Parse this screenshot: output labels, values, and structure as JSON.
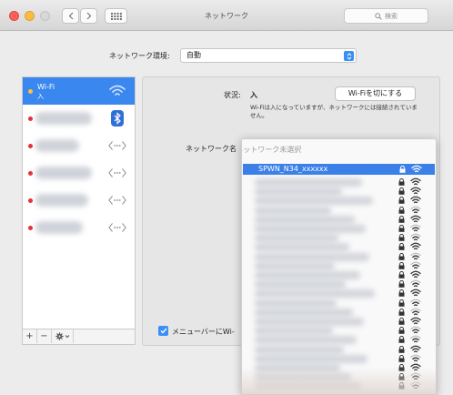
{
  "window": {
    "title": "ネットワーク",
    "search_placeholder": "検索"
  },
  "location": {
    "label": "ネットワーク環境:",
    "value": "自動"
  },
  "sidebar": {
    "items": [
      {
        "name": "Wi-Fi",
        "status": "入",
        "dot": "yellow",
        "icon": "wifi-icon",
        "selected": true
      },
      {
        "name": "",
        "status": "",
        "dot": "red",
        "icon": "bluetooth-icon",
        "selected": false
      },
      {
        "name": "",
        "status": "",
        "dot": "red",
        "icon": "ethernet-icon",
        "selected": false
      },
      {
        "name": "",
        "status": "",
        "dot": "red",
        "icon": "ethernet-icon",
        "selected": false
      },
      {
        "name": "",
        "status": "",
        "dot": "red",
        "icon": "ethernet-icon",
        "selected": false
      },
      {
        "name": "",
        "status": "",
        "dot": "red",
        "icon": "ethernet-icon",
        "selected": false
      }
    ],
    "tools": {
      "add": "+",
      "remove": "−",
      "gear": "gear-icon"
    }
  },
  "detail": {
    "status_label": "状況:",
    "status_value": "入",
    "wifi_off_button": "Wi-Fiを切にする",
    "status_description": "Wi-Fiは入になっていますが、ネットワークには接続されていません。",
    "network_name_label": "ネットワーク名",
    "show_in_menubar_label": "メニューバーにWi-",
    "show_in_menubar_checked": true
  },
  "dropdown": {
    "header": "✓ ネットワーク未選択",
    "selected_network": "SPWN_N34_xxxxxx",
    "rows": [
      {
        "locked": true,
        "signal": 3
      },
      {
        "locked": true,
        "signal": 3
      },
      {
        "locked": true,
        "signal": 3
      },
      {
        "locked": true,
        "signal": 2
      },
      {
        "locked": true,
        "signal": 3
      },
      {
        "locked": true,
        "signal": 2
      },
      {
        "locked": true,
        "signal": 2
      },
      {
        "locked": true,
        "signal": 3
      },
      {
        "locked": true,
        "signal": 2
      },
      {
        "locked": true,
        "signal": 2
      },
      {
        "locked": true,
        "signal": 3
      },
      {
        "locked": true,
        "signal": 2
      },
      {
        "locked": true,
        "signal": 3
      },
      {
        "locked": true,
        "signal": 2
      },
      {
        "locked": true,
        "signal": 2
      },
      {
        "locked": true,
        "signal": 3
      },
      {
        "locked": true,
        "signal": 2
      },
      {
        "locked": true,
        "signal": 2
      },
      {
        "locked": true,
        "signal": 3
      },
      {
        "locked": true,
        "signal": 2
      },
      {
        "locked": true,
        "signal": 3
      },
      {
        "locked": true,
        "signal": 2
      },
      {
        "locked": true,
        "signal": 2
      }
    ]
  },
  "colors": {
    "accent": "#3b80e8",
    "status_red": "#e2313b",
    "status_yellow": "#f7c53b"
  }
}
